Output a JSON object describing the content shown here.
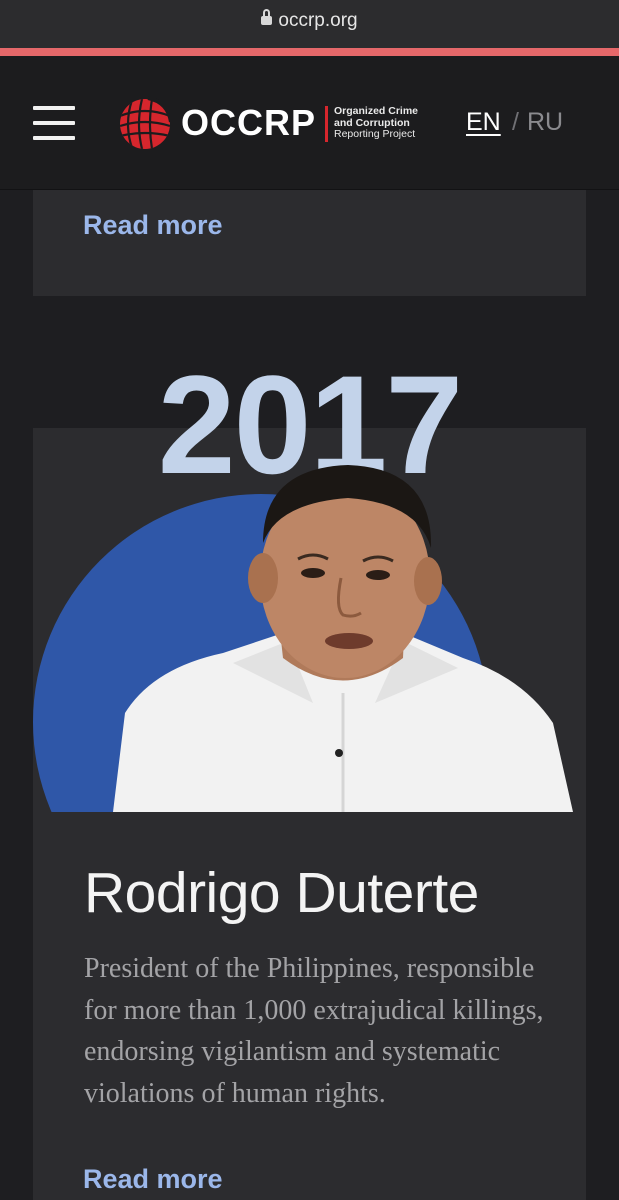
{
  "browser": {
    "url": "occrp.org"
  },
  "header": {
    "logo_text": "OCCRP",
    "tagline": [
      "Organized Crime",
      "and Corruption",
      "Reporting Project"
    ],
    "lang_active": "EN",
    "lang_separator": "/",
    "lang_other": "RU"
  },
  "previous_card": {
    "read_more": "Read more"
  },
  "entry": {
    "year": "2017",
    "name": "Rodrigo Duterte",
    "description": "President of the Philippines, responsible for more than 1,000 extrajudical killings, endorsing vigilantism and systematic violations of human rights.",
    "read_more": "Read more"
  },
  "icons": {
    "menu": "hamburger-menu-icon",
    "lock": "lock-icon",
    "logo": "occrp-globe-logo"
  },
  "colors": {
    "accent_link": "#9bb7ea",
    "brand_red": "#d6262d",
    "circle_blue": "#2f57a8",
    "year_color": "#c3d3ea",
    "progress_bar": "#e5686a"
  }
}
